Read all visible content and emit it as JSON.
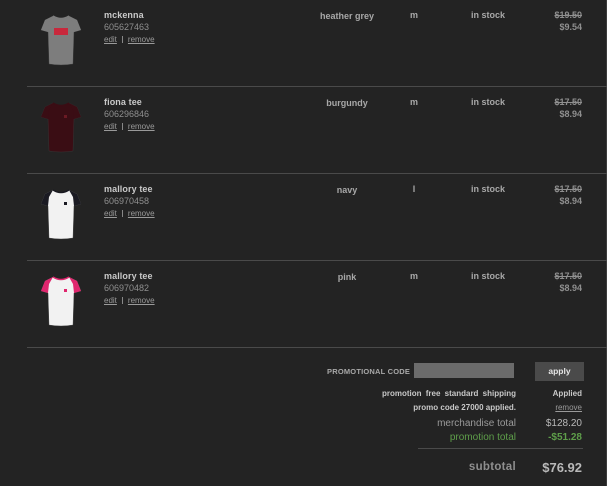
{
  "cart": {
    "items": [
      {
        "name": "mckenna",
        "sku": "605627463",
        "edit_label": "edit",
        "remove_label": "remove",
        "color": "heather grey",
        "size": "m",
        "availability": "in stock",
        "original_price": "$19.50",
        "sale_price": "$9.54",
        "tee_color": "#7d7d7d",
        "sleeve_color": "#7d7d7d",
        "graphic_color": "#c8283c"
      },
      {
        "name": "fiona tee",
        "sku": "606296846",
        "edit_label": "edit",
        "remove_label": "remove",
        "color": "burgundy",
        "size": "m",
        "availability": "in stock",
        "original_price": "$17.50",
        "sale_price": "$8.94",
        "tee_color": "#3a0d14",
        "sleeve_color": "#3a0d14",
        "graphic_color": "#6b1a24"
      },
      {
        "name": "mallory tee",
        "sku": "606970458",
        "edit_label": "edit",
        "remove_label": "remove",
        "color": "navy",
        "size": "l",
        "availability": "in stock",
        "original_price": "$17.50",
        "sale_price": "$8.94",
        "tee_color": "#f2f2f2",
        "sleeve_color": "#1a1a22",
        "graphic_color": "#1a1a22"
      },
      {
        "name": "mallory tee",
        "sku": "606970482",
        "edit_label": "edit",
        "remove_label": "remove",
        "color": "pink",
        "size": "m",
        "availability": "in stock",
        "original_price": "$17.50",
        "sale_price": "$8.94",
        "tee_color": "#f2f2f2",
        "sleeve_color": "#e0266e",
        "graphic_color": "#e0266e"
      }
    ]
  },
  "promo": {
    "label": "PROMOTIONAL CODE",
    "input_value": "",
    "apply_label": "apply",
    "promotion_text": "promotion  free standard shipping",
    "status": "Applied",
    "code_text": "promo code 27000 applied.",
    "remove_label": "remove"
  },
  "totals": {
    "merchandise_label": "merchandise total",
    "merchandise_value": "$128.20",
    "promotion_label": "promotion total",
    "promotion_value": "-$51.28",
    "subtotal_label": "subtotal",
    "subtotal_value": "$76.92"
  },
  "colors": {
    "background": "#232323",
    "promotion_green": "#5e9e4a"
  }
}
